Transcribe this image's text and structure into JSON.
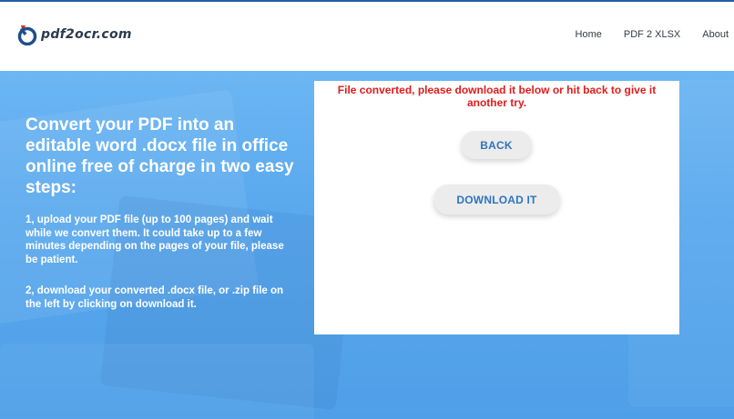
{
  "header": {
    "logo_text": "pdf2ocr.com",
    "logo_icon": "pdf2ocr-logo-icon",
    "nav": [
      {
        "label": "Home"
      },
      {
        "label": "PDF 2 XLSX"
      },
      {
        "label": "About"
      }
    ]
  },
  "hero": {
    "heading": "Convert your PDF into an editable word .docx file in office online free of charge in two easy steps:",
    "step1": "1, upload your PDF file (up to 100 pages) and wait while we convert them. It could take up to a few minutes depending on the pages of your file, please be patient.",
    "step2": "2, download your converted .docx file, or .zip file on the left by clicking on download it."
  },
  "result": {
    "message": "File converted, please download it below or hit back to give it another try.",
    "back_label": "BACK",
    "download_label": "DOWNLOAD IT"
  },
  "colors": {
    "header_bg": "#ffffff",
    "top_rule": "#1f5fa8",
    "hero_bg": "#5aa9ee",
    "message": "#e11b1b",
    "button_text": "#2f74c0",
    "button_bg": "#ececec"
  }
}
